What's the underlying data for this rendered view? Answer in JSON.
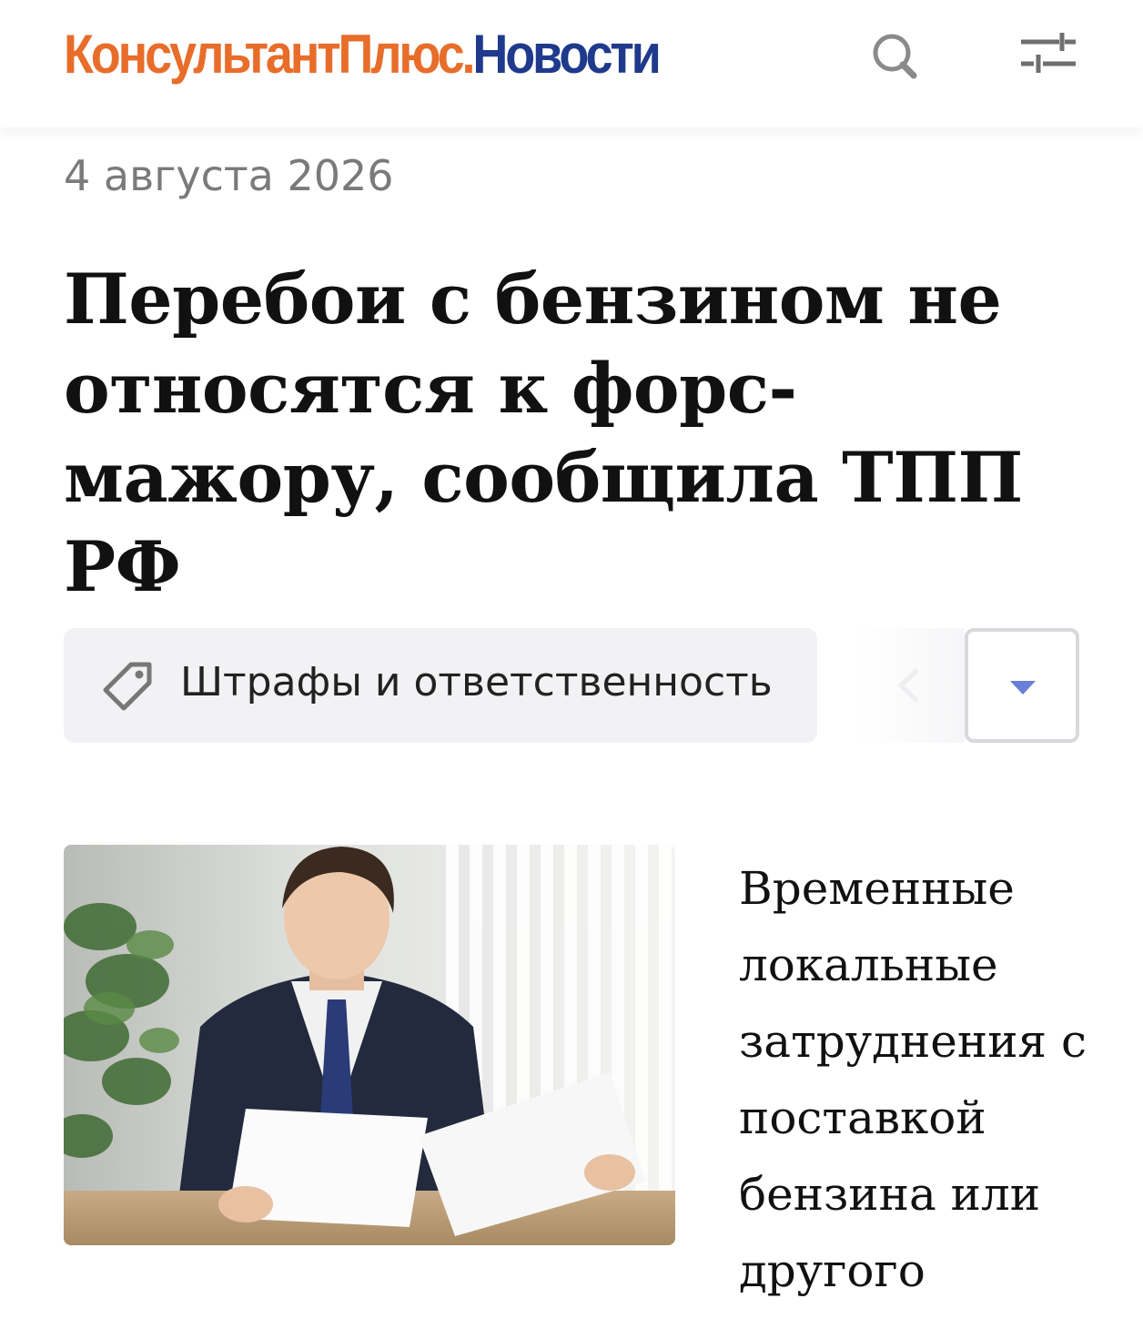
{
  "header": {
    "logo_brand": "КонсультантПлюс",
    "logo_dot": ".",
    "logo_section": "Новости",
    "search_icon": "search-icon",
    "filter_icon": "sliders-icon",
    "brand_color": "#e86d2a",
    "section_color": "#1f3a8c"
  },
  "article": {
    "date": "4 августа 2026",
    "title": "Перебои с бензином не относятся к форс-мажору, сообщила ТПП РФ",
    "lead": "Временные локальные затруднения с поставкой бензина или другого"
  },
  "tags": {
    "current": "Штрафы и ответственность",
    "tag_icon": "tag-icon",
    "prev_icon": "chevron-left-icon",
    "dropdown_icon": "caret-down-icon",
    "accent_color": "#6a7fd6"
  },
  "photo": {
    "icon": "article-photo"
  }
}
